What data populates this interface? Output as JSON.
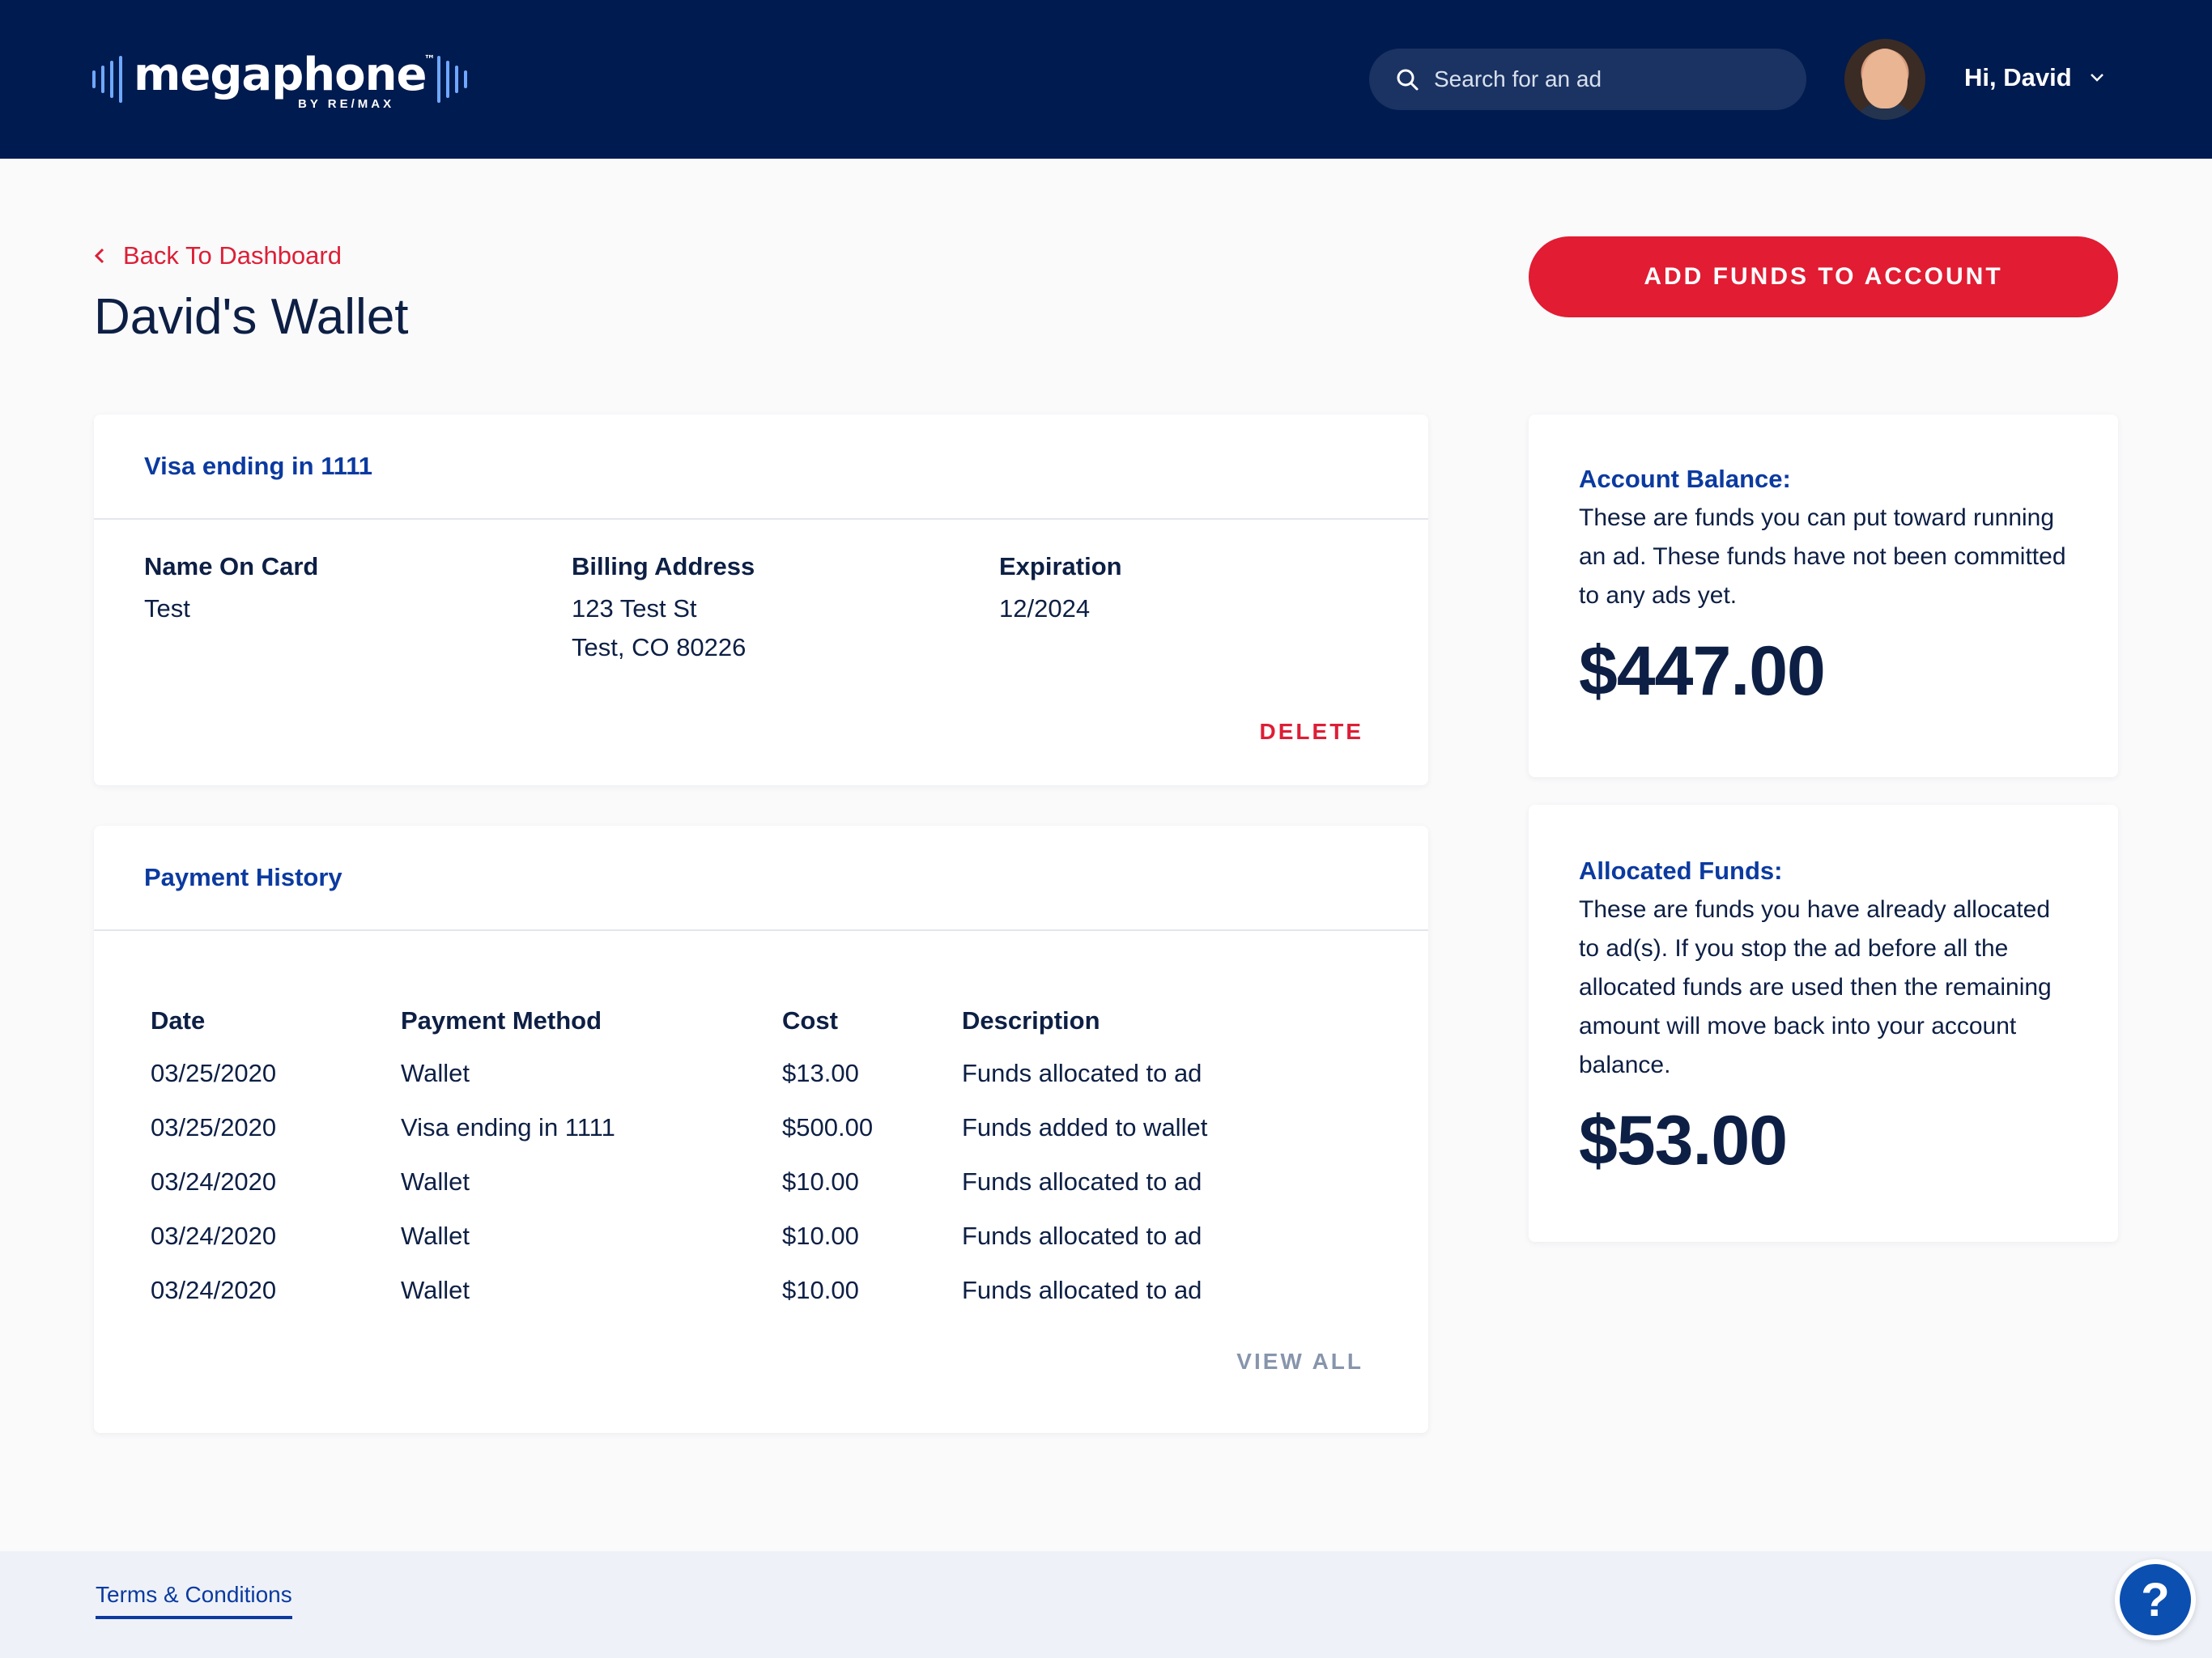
{
  "brand": {
    "name": "megaphone",
    "trademark": "™",
    "tagline": "BY RE/MAX"
  },
  "header": {
    "search_placeholder": "Search for an ad",
    "greeting": "Hi, David"
  },
  "page": {
    "back_label": "Back To Dashboard",
    "title": "David's Wallet",
    "add_funds_label": "ADD FUNDS TO ACCOUNT"
  },
  "card": {
    "title": "Visa ending in 1111",
    "name_label": "Name On Card",
    "name_value": "Test",
    "billing_label": "Billing Address",
    "billing_line1": "123 Test St",
    "billing_line2": "Test, CO 80226",
    "expiration_label": "Expiration",
    "expiration_value": "12/2024",
    "delete_label": "DELETE"
  },
  "history": {
    "title": "Payment History",
    "columns": [
      "Date",
      "Payment Method",
      "Cost",
      "Description"
    ],
    "rows": [
      [
        "03/25/2020",
        "Wallet",
        "$13.00",
        "Funds allocated to ad"
      ],
      [
        "03/25/2020",
        "Visa ending in 1111",
        "$500.00",
        "Funds added to wallet"
      ],
      [
        "03/24/2020",
        "Wallet",
        "$10.00",
        "Funds allocated to ad"
      ],
      [
        "03/24/2020",
        "Wallet",
        "$10.00",
        "Funds allocated to ad"
      ],
      [
        "03/24/2020",
        "Wallet",
        "$10.00",
        "Funds allocated to ad"
      ]
    ],
    "view_all_label": "VIEW ALL"
  },
  "balance": {
    "title": "Account Balance:",
    "description": "These are funds you can put toward running an ad. These funds have not been committed to any ads yet.",
    "amount": "$447.00"
  },
  "allocated": {
    "title": "Allocated Funds:",
    "description": "These are funds you have already allocated to ad(s). If you stop the ad before all the allocated funds are used then the remaining amount will move back into your account balance.",
    "amount": "$53.00"
  },
  "footer": {
    "terms_label": "Terms & Conditions",
    "help_label": "?"
  },
  "colors": {
    "navy": "#001b4f",
    "accent_red": "#e11c33",
    "link_blue": "#0b3aa0"
  }
}
